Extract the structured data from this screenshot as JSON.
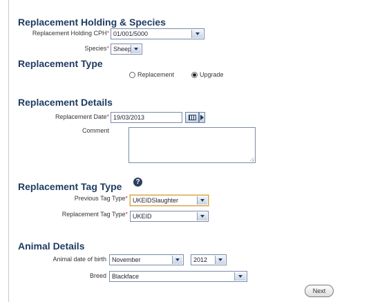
{
  "sections": {
    "holding_species": "Replacement Holding & Species",
    "replacement_type": "Replacement Type",
    "replacement_details": "Replacement Details",
    "replacement_tag_type": "Replacement Tag Type",
    "animal_details": "Animal Details"
  },
  "fields": {
    "holding_cph": {
      "label": "Replacement Holding CPH",
      "value": "01/001/5000"
    },
    "species": {
      "label": "Species",
      "value": "Sheep"
    },
    "replacement_date": {
      "label": "Replacement Date",
      "value": "19/03/2013"
    },
    "comment": {
      "label": "Comment",
      "value": ""
    },
    "previous_tag_type": {
      "label": "Previous Tag Type",
      "value": "UKEIDSlaughter"
    },
    "replacement_tag_type": {
      "label": "Replacement Tag Type",
      "value": "UKEID"
    },
    "animal_dob": {
      "label": "Animal date of birth",
      "month": "November",
      "year": "2012"
    },
    "breed": {
      "label": "Breed",
      "value": "Blackface"
    }
  },
  "required_marker": "*",
  "replacement_type_options": [
    {
      "label": "Replacement",
      "selected": false
    },
    {
      "label": "Upgrade",
      "selected": true
    }
  ],
  "help_icon": "?",
  "buttons": {
    "next": "Next"
  },
  "icons": {
    "dropdown": "chevron-down-icon",
    "calendar": "calendar-icon",
    "arrow": "triangle-right-icon",
    "help": "help-icon"
  },
  "colors": {
    "section_title": "#1f3b63",
    "required": "#d23c3c",
    "field_border": "#7a8aa8",
    "highlight_border": "#d4a24a"
  }
}
